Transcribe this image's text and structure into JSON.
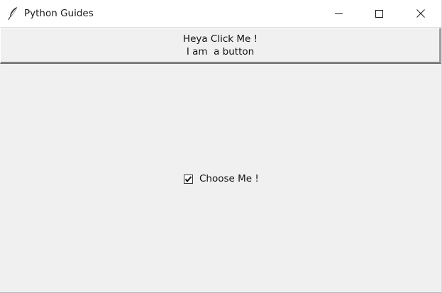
{
  "window": {
    "title": "Python Guides",
    "app_icon": "feather-icon",
    "controls": {
      "minimize_icon": "minimize-icon",
      "maximize_icon": "maximize-icon",
      "close_icon": "close-icon"
    }
  },
  "main_button": {
    "line1": "Heya Click Me !",
    "line2": "I am  a button"
  },
  "checkbox": {
    "label": "Choose Me !",
    "checked": true
  },
  "colors": {
    "background": "#f0f0f0",
    "titlebar": "#ffffff",
    "text": "#111111"
  }
}
